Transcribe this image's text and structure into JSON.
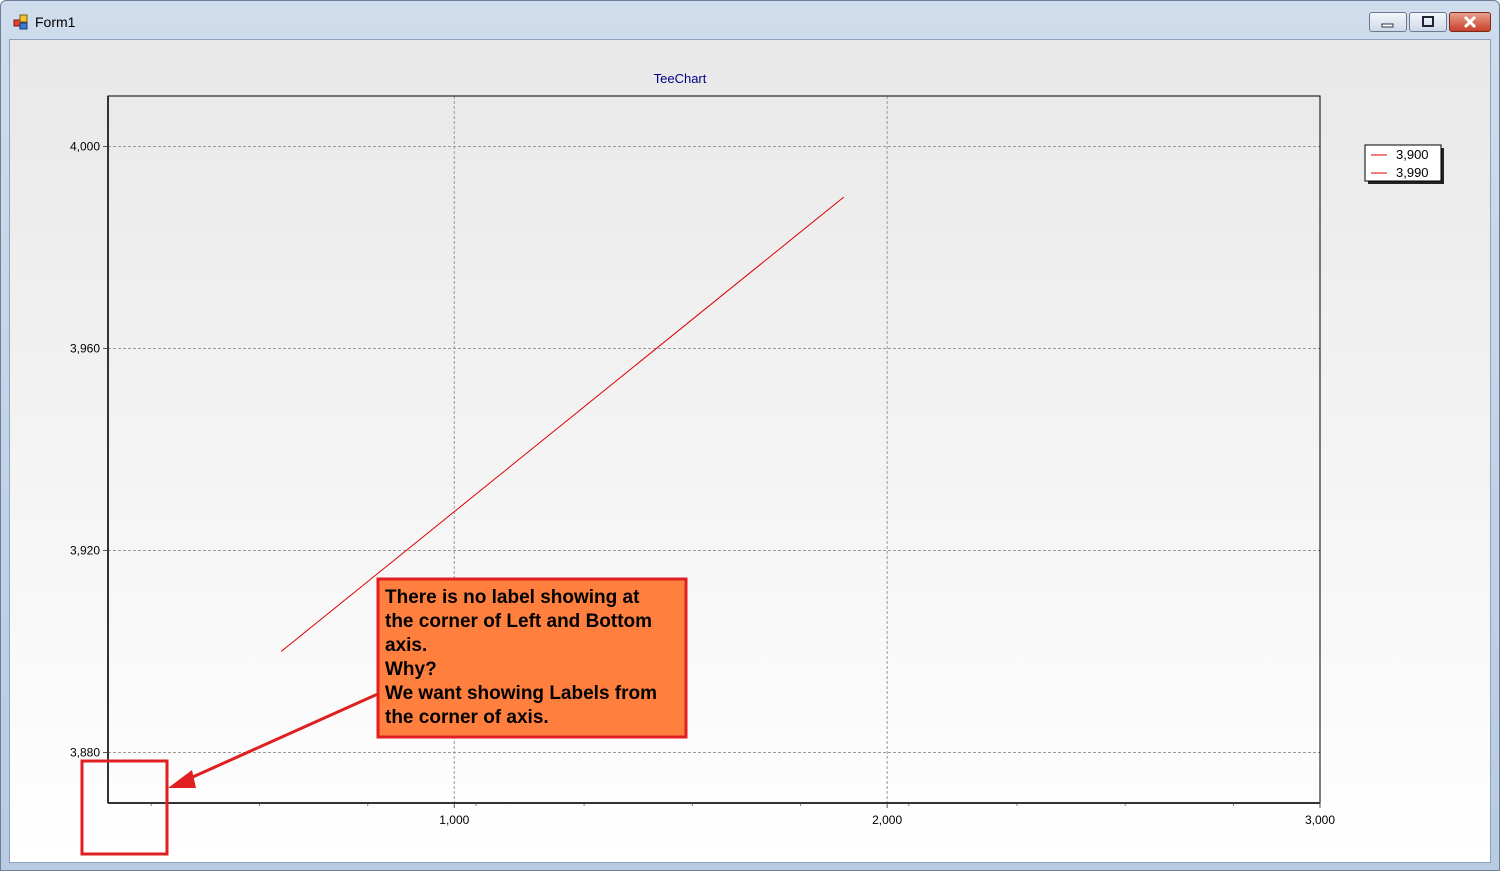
{
  "window": {
    "title": "Form1"
  },
  "chart_data": {
    "type": "line",
    "title": "TeeChart",
    "xlabel": "",
    "ylabel": "",
    "xlim": [
      200,
      3000
    ],
    "ylim": [
      3870,
      4010
    ],
    "x_ticks": [
      1000,
      2000,
      3000
    ],
    "x_tick_labels": [
      "1,000",
      "2,000",
      "3,000"
    ],
    "y_ticks": [
      3880,
      3920,
      3960,
      4000
    ],
    "y_tick_labels": [
      "3,880",
      "3,920",
      "3,960",
      "4,000"
    ],
    "grid": true,
    "legend_position": "right",
    "legend": [
      "3,900",
      "3,990"
    ],
    "series": [
      {
        "x": [
          600,
          1900
        ],
        "y": [
          3900,
          3990
        ],
        "color": "#e00000"
      }
    ]
  },
  "annotation": {
    "lines": [
      "There is no label showing at",
      "the corner of Left and Bottom",
      "axis.",
      "Why?",
      "We want showing Labels from",
      "the corner of axis."
    ],
    "fill": "#fe7f3e",
    "border": "#e02020"
  }
}
